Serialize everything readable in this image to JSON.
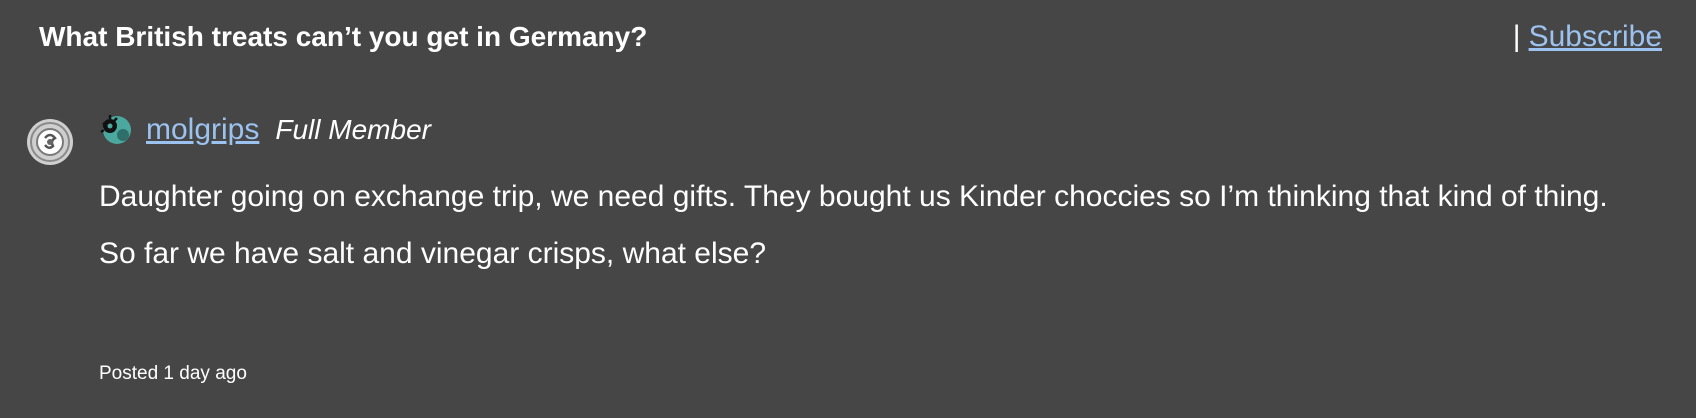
{
  "topic": {
    "title": "What British treats can’t you get in Germany?",
    "separator": "|",
    "subscribe_label": "Subscribe"
  },
  "post": {
    "avatar_icon": "user-avatar-icon",
    "badge_icon": "member-badge-icon",
    "author": "molgrips",
    "rank": "Full Member",
    "paragraphs": [
      "Daughter going on exchange trip, we need gifts. They bought us Kinder choccies so I’m thinking that kind of thing.",
      "So far we have salt and vinegar crisps, what else?"
    ],
    "posted": "Posted 1 day ago"
  },
  "colors": {
    "background": "#464646",
    "link": "#9cc3ef",
    "text": "#ffffff"
  }
}
